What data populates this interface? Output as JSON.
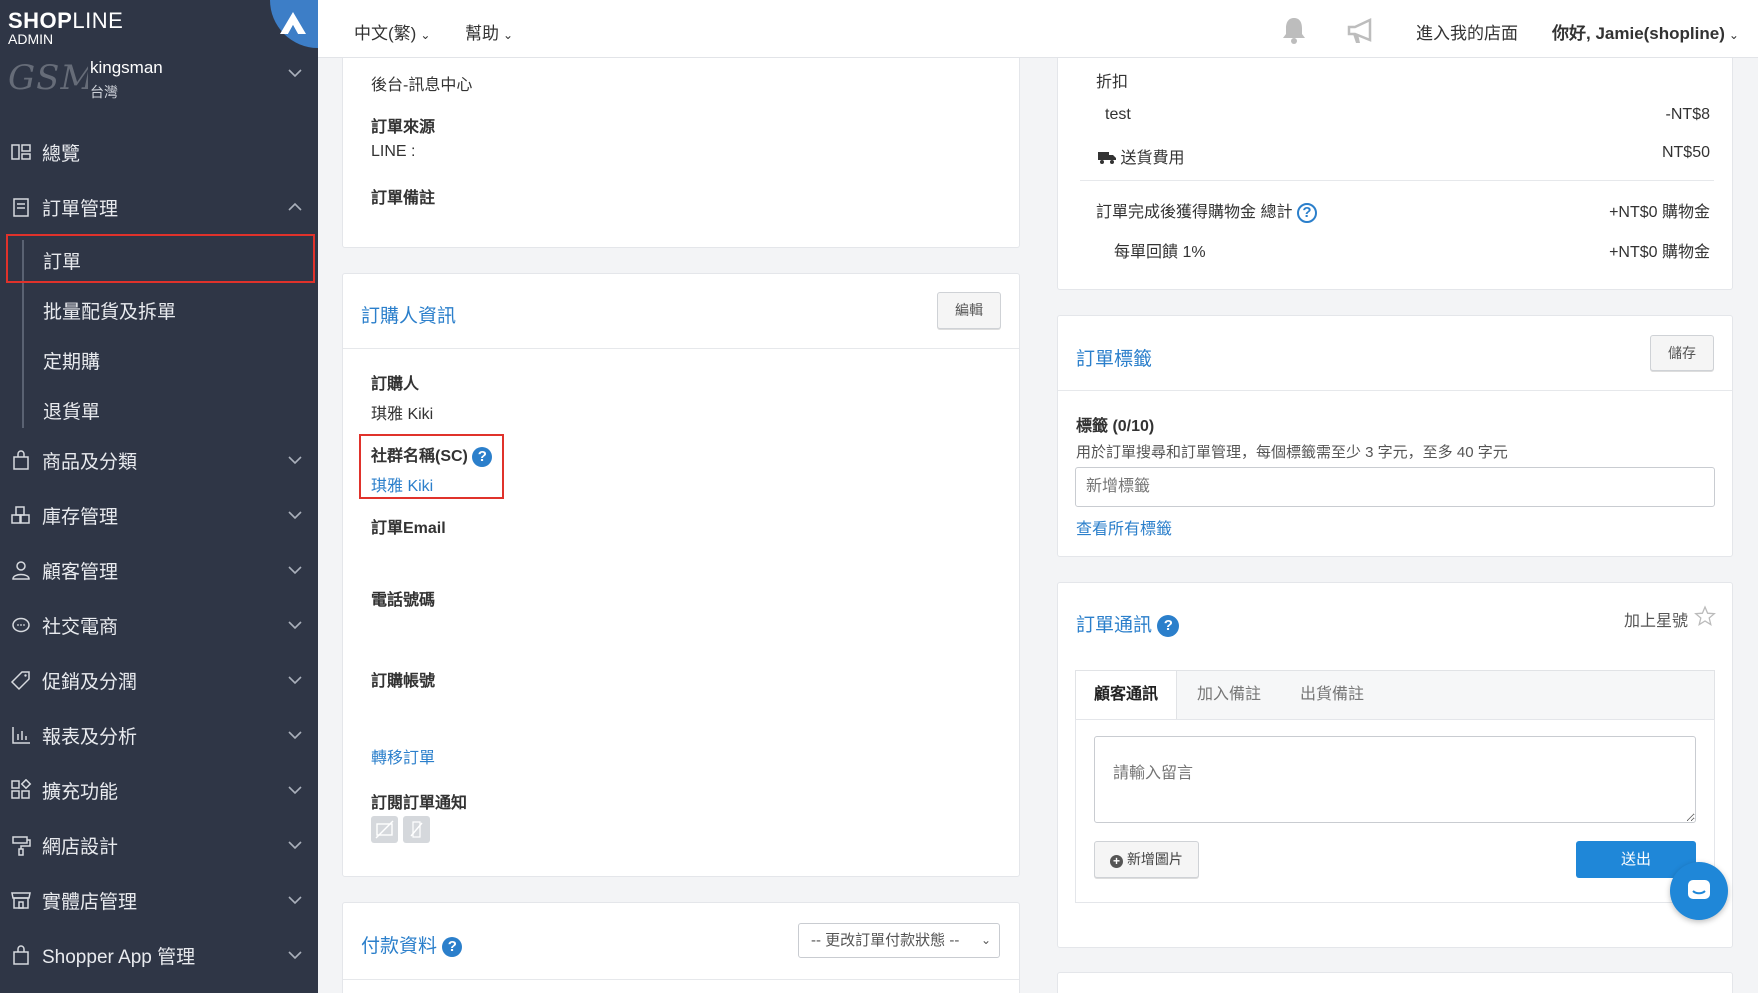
{
  "brand": {
    "name_bold": "SHOP",
    "name_thin": "LINE",
    "sub": "ADMIN"
  },
  "store": {
    "logo_text": "GSM",
    "name": "kingsman",
    "region": "台灣"
  },
  "sidebar": {
    "items": [
      {
        "label": "總覽",
        "icon": "dashboard-icon"
      },
      {
        "label": "訂單管理",
        "icon": "orders-icon"
      },
      {
        "label": "商品及分類",
        "icon": "bag-icon"
      },
      {
        "label": "庫存管理",
        "icon": "inventory-icon"
      },
      {
        "label": "顧客管理",
        "icon": "customer-icon"
      },
      {
        "label": "社交電商",
        "icon": "chat-icon"
      },
      {
        "label": "促銷及分潤",
        "icon": "tag-icon"
      },
      {
        "label": "報表及分析",
        "icon": "chart-icon"
      },
      {
        "label": "擴充功能",
        "icon": "apps-icon"
      },
      {
        "label": "網店設計",
        "icon": "paint-icon"
      },
      {
        "label": "實體店管理",
        "icon": "store-icon"
      },
      {
        "label": "Shopper App 管理",
        "icon": "shopper-bag-icon"
      }
    ],
    "sub_items": [
      "訂單",
      "批量配貨及拆單",
      "定期購",
      "退貨單"
    ]
  },
  "topbar": {
    "language": "中文(繁)",
    "help": "幫助",
    "visit_store": "進入我的店面",
    "greeting": "你好, Jamie(shopline)"
  },
  "source_panel": {
    "channel": "後台-訊息中心",
    "order_source_label": "訂單來源",
    "order_source_value": "LINE :",
    "order_note_label": "訂單備註"
  },
  "buyer_panel": {
    "title": "訂購人資訊",
    "edit": "編輯",
    "buyer_label": "訂購人",
    "buyer_value": "琪雅 Kiki",
    "social_label": "社群名稱(SC)",
    "social_value": "琪雅 Kiki",
    "email_label": "訂單Email",
    "phone_label": "電話號碼",
    "account_label": "訂購帳號",
    "transfer_link": "轉移訂單",
    "subscribe_label": "訂閱訂單通知"
  },
  "payment_panel": {
    "title": "付款資料",
    "select_value": "-- 更改訂單付款狀態 --"
  },
  "summary_panel": {
    "discount_label": "折扣",
    "discount_name": "test",
    "discount_value": "-NT$8",
    "shipping_label": "送貨費用",
    "shipping_value": "NT$50",
    "credit_label": "訂單完成後獲得購物金 總計",
    "credit_value": "+NT$0 購物金",
    "rebate_label": "每單回饋 1%",
    "rebate_value": "+NT$0 購物金"
  },
  "tags_panel": {
    "title": "訂單標籤",
    "save": "儲存",
    "count_label": "標籤 (0/10)",
    "hint": "用於訂單搜尋和訂單管理，每個標籤需至少 3 字元，至多 40 字元",
    "input_placeholder": "新增標籤",
    "view_all": "查看所有標籤"
  },
  "comm_panel": {
    "title": "訂單通訊",
    "star_label": "加上星號",
    "tabs": [
      "顧客通訊",
      "加入備註",
      "出貨備註"
    ],
    "message_placeholder": "請輸入留言",
    "add_image": "新增圖片",
    "send": "送出"
  },
  "colors": {
    "sidebar_bg": "#2f3646",
    "accent": "#2b7fcb",
    "highlight": "#e0322b",
    "primary_button": "#1f87d8"
  }
}
